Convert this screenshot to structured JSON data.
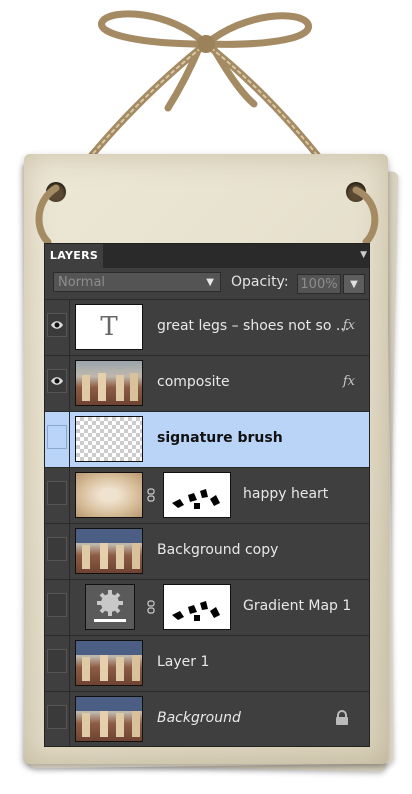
{
  "panel": {
    "tab_label": "LAYERS",
    "blend_mode": "Normal",
    "opacity_label": "Opacity:",
    "opacity_value": "100%"
  },
  "icons": {
    "visibility": "eye-icon",
    "link": "chain-link-icon",
    "effects": "fx-icon",
    "lock": "lock-icon"
  },
  "layers": [
    {
      "name": "great legs – shoes not so ...",
      "visible": true,
      "thumb": "text",
      "thumb_glyph": "T",
      "fx": "fx",
      "selected": false
    },
    {
      "name": "composite",
      "visible": true,
      "thumb": "photo",
      "fx": "fx",
      "selected": false
    },
    {
      "name": "signature brush",
      "visible": false,
      "thumb": "transparent",
      "selected": true
    },
    {
      "name": "happy heart",
      "visible": false,
      "thumb": "vignette",
      "has_mask": true,
      "selected": false
    },
    {
      "name": "Background copy",
      "visible": false,
      "thumb": "photo",
      "selected": false
    },
    {
      "name": "Gradient Map 1",
      "visible": false,
      "thumb": "adjustment",
      "has_mask": true,
      "selected": false
    },
    {
      "name": "Layer 1",
      "visible": false,
      "thumb": "photo",
      "selected": false
    },
    {
      "name": "Background",
      "visible": false,
      "thumb": "photo",
      "locked": true,
      "selected": false
    }
  ],
  "colors": {
    "panel_bg": "#3f3f3f",
    "selection": "#b9d4f7",
    "board": "#e6e0cd",
    "twine": "#b39c74"
  }
}
